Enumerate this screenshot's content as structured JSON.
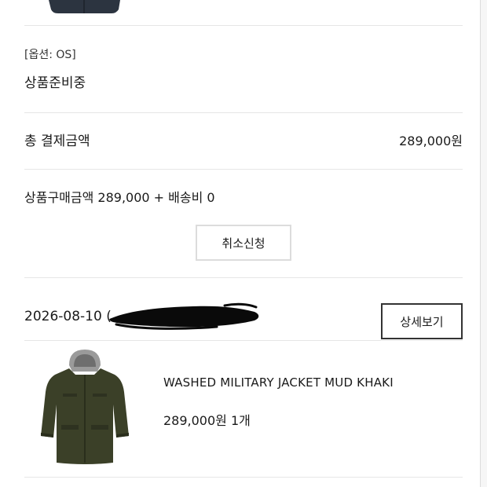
{
  "top_item": {
    "image": "navy-garment-partial",
    "option": "[옵션: OS]",
    "status": "상품준비중"
  },
  "payment": {
    "total_label": "총 결제금액",
    "total_value": "289,000원",
    "breakdown": "상품구매금액 289,000 + 배송비 0",
    "cancel_button": "취소신청"
  },
  "order": {
    "date": "2026-08-10 (",
    "detail_button": "상세보기",
    "redaction": "black-scribble"
  },
  "product": {
    "image": "olive-hooded-parka",
    "name": "WASHED MILITARY JACKET MUD KHAKI",
    "price_qty": "289,000원 1개"
  }
}
